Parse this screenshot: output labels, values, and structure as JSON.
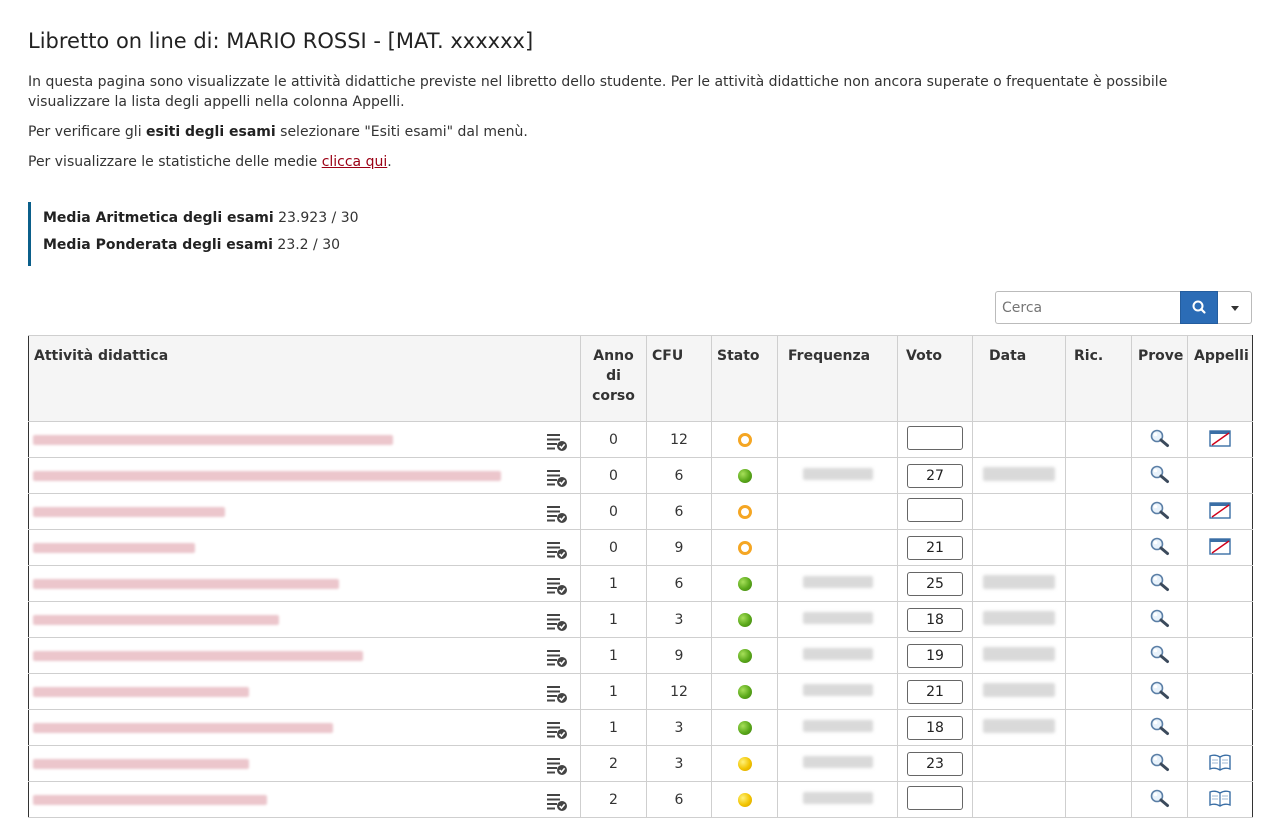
{
  "page": {
    "title": "Libretto on line di: MARIO ROSSI - [MAT. xxxxxx]",
    "intro": "In questa pagina sono visualizzate le attività didattiche previste nel libretto dello studente. Per le attività didattiche non ancora superate o frequentate è possibile visualizzare la lista degli appelli nella colonna Appelli.",
    "esiti_pre": "Per verificare gli ",
    "esiti_bold": "esiti degli esami",
    "esiti_post": " selezionare \"Esiti esami\" dal menù.",
    "stat_pre": "Per visualizzare le statistiche delle medie ",
    "stat_link": "clicca qui",
    "stat_post": "."
  },
  "medie": {
    "aritmetica_label": "Media Aritmetica degli esami",
    "aritmetica_value": "23.923 / 30",
    "ponderata_label": "Media Ponderata degli esami",
    "ponderata_value": "23.2 / 30"
  },
  "search": {
    "placeholder": "Cerca",
    "icon": "search-icon"
  },
  "table": {
    "headers": {
      "attivita": "Attività didattica",
      "anno": "Anno di corso",
      "cfu": "CFU",
      "stato": "Stato",
      "frequenza": "Frequenza",
      "voto": "Voto",
      "data": "Data",
      "ric": "Ric.",
      "prove": "Prove",
      "appelli": "Appelli"
    },
    "rows": [
      {
        "anno": "0",
        "cfu": "12",
        "stato": "ring",
        "freq": false,
        "voto": "",
        "data": false,
        "appelli": "calendar-crossed"
      },
      {
        "anno": "0",
        "cfu": "6",
        "stato": "green",
        "freq": true,
        "voto": "27",
        "data": true,
        "appelli": ""
      },
      {
        "anno": "0",
        "cfu": "6",
        "stato": "ring",
        "freq": false,
        "voto": "",
        "data": false,
        "appelli": "calendar-crossed"
      },
      {
        "anno": "0",
        "cfu": "9",
        "stato": "ring",
        "freq": false,
        "voto": "21",
        "data": false,
        "appelli": "calendar-crossed"
      },
      {
        "anno": "1",
        "cfu": "6",
        "stato": "green",
        "freq": true,
        "voto": "25",
        "data": true,
        "appelli": ""
      },
      {
        "anno": "1",
        "cfu": "3",
        "stato": "green",
        "freq": true,
        "voto": "18",
        "data": true,
        "appelli": ""
      },
      {
        "anno": "1",
        "cfu": "9",
        "stato": "green",
        "freq": true,
        "voto": "19",
        "data": true,
        "appelli": ""
      },
      {
        "anno": "1",
        "cfu": "12",
        "stato": "green",
        "freq": true,
        "voto": "21",
        "data": true,
        "appelli": ""
      },
      {
        "anno": "1",
        "cfu": "3",
        "stato": "green",
        "freq": true,
        "voto": "18",
        "data": true,
        "appelli": ""
      },
      {
        "anno": "2",
        "cfu": "3",
        "stato": "yellow",
        "freq": true,
        "voto": "23",
        "data": false,
        "appelli": "book"
      },
      {
        "anno": "2",
        "cfu": "6",
        "stato": "yellow",
        "freq": true,
        "voto": "",
        "data": false,
        "appelli": "book"
      }
    ]
  },
  "colors": {
    "accent": "#2b6cb6",
    "link": "#9b0014",
    "medie_border": "#0b5f8a"
  }
}
